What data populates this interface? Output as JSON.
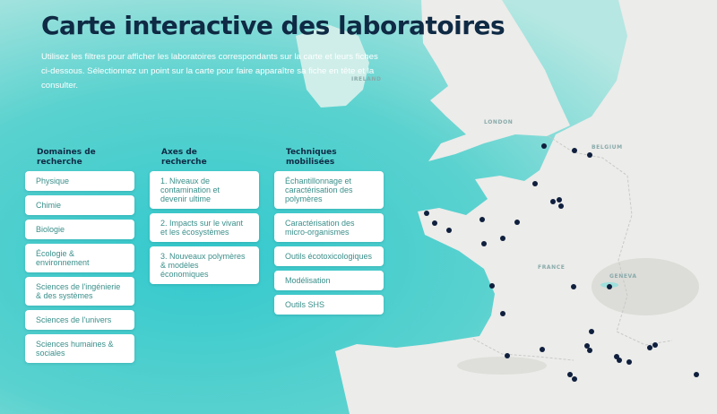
{
  "page": {
    "title": "Carte interactive des laboratoires",
    "intro": "Utilisez les filtres pour afficher les laboratoires correspondants sur la carte et leurs fiches ci-dessous. Sélectionnez un point sur la carte pour faire apparaître sa fiche en tête et la consulter."
  },
  "filters": {
    "domains": {
      "heading": "Domaines de recherche",
      "items": [
        "Physique",
        "Chimie",
        "Biologie",
        "Écologie & environnement",
        "Sciences de l'ingénierie & des systèmes",
        "Sciences de l'univers",
        "Sciences humaines & sociales"
      ]
    },
    "axes": {
      "heading": "Axes de recherche",
      "items": [
        "1. Niveaux de contamination et devenir ultime",
        "2. Impacts sur le vivant et les écosystèmes",
        "3. Nouveaux polymères & modèles économiques"
      ]
    },
    "techniques": {
      "heading": "Techniques mobilisées",
      "items": [
        "Échantillonnage et caractérisation des polymères",
        "Caractérisation des micro-organismes",
        "Outils écotoxicologiques",
        "Modélisation",
        "Outils SHS"
      ]
    }
  },
  "map": {
    "labels": {
      "ireland": "IRELAND",
      "london": "LONDON",
      "belgium": "BELGIUM",
      "france": "FRANCE",
      "geneva": "GENEVA"
    },
    "marker_color": "#0f1f3d",
    "sea_color": "#49cfcf",
    "land_color": "#ececea"
  }
}
